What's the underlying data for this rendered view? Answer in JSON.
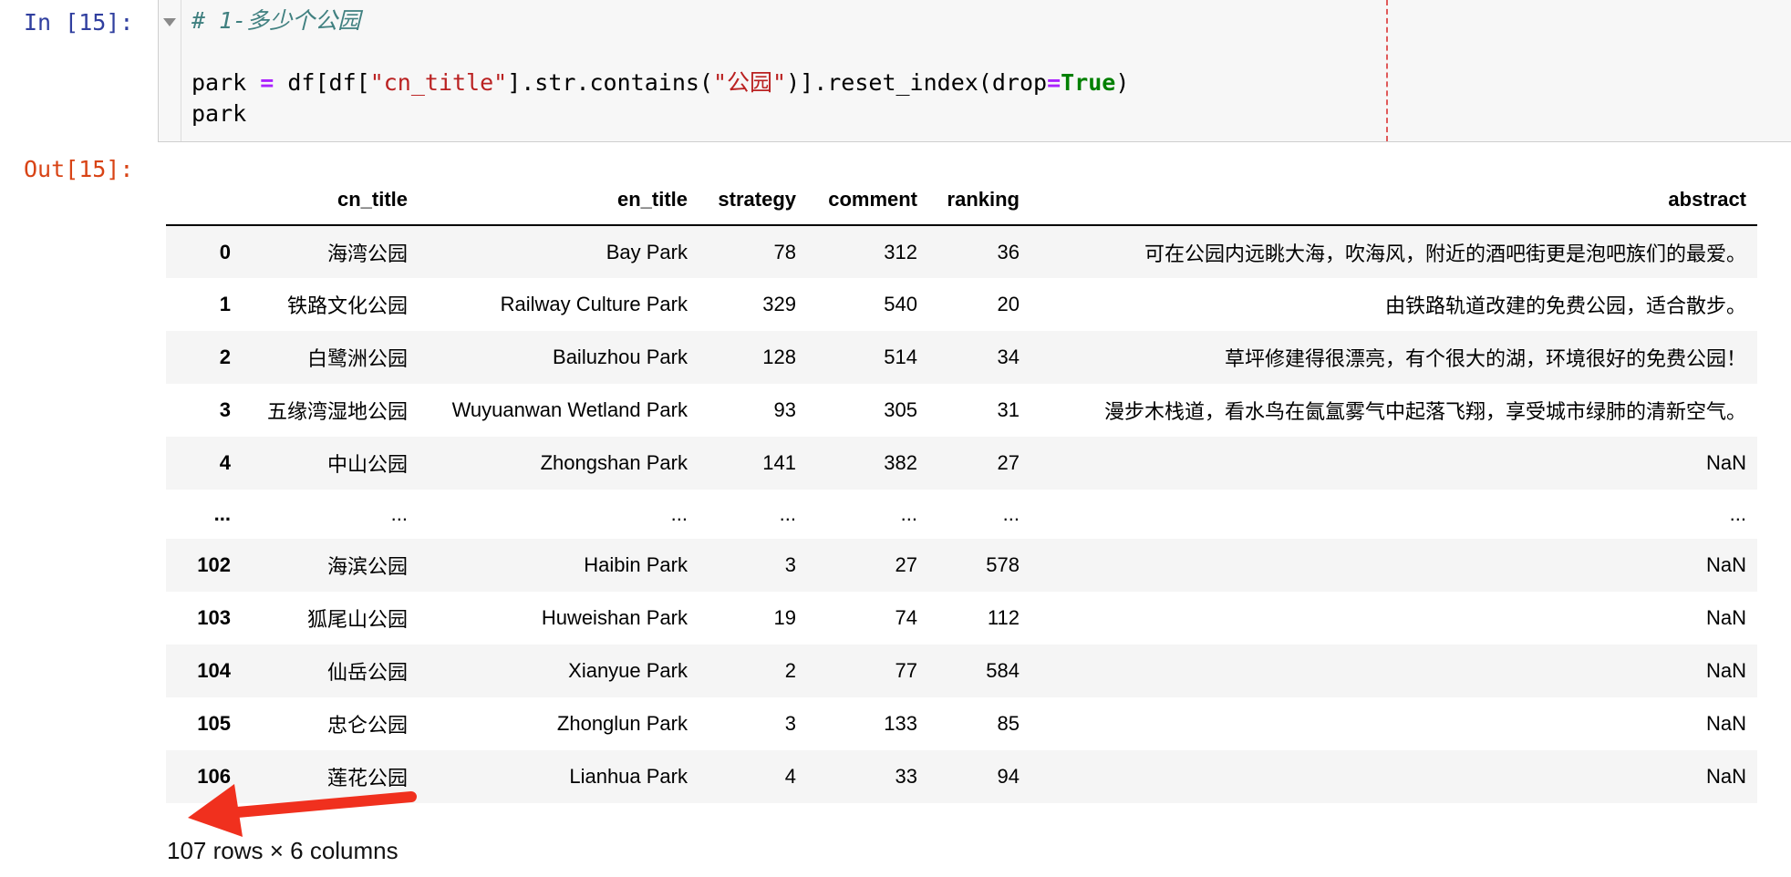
{
  "cell": {
    "in_prompt": "In [15]:",
    "out_prompt": "Out[15]:",
    "code": {
      "comment": "# 1-多少个公园",
      "line2_a": "park ",
      "line2_eq": "=",
      "line2_b": " df[df[",
      "line2_s1": "\"cn_title\"",
      "line2_c": "].str.contains(",
      "line2_s2": "\"公园\"",
      "line2_d": ")].reset_index(drop",
      "line2_eq2": "=",
      "line2_kw": "True",
      "line2_e": ")",
      "line3": "park"
    }
  },
  "table": {
    "columns": [
      "cn_title",
      "en_title",
      "strategy",
      "comment",
      "ranking",
      "abstract"
    ],
    "rows": [
      [
        "0",
        "海湾公园",
        "Bay Park",
        "78",
        "312",
        "36",
        "可在公园内远眺大海，吹海风，附近的酒吧街更是泡吧族们的最爱。"
      ],
      [
        "1",
        "铁路文化公园",
        "Railway Culture Park",
        "329",
        "540",
        "20",
        "由铁路轨道改建的免费公园，适合散步。"
      ],
      [
        "2",
        "白鹭洲公园",
        "Bailuzhou Park",
        "128",
        "514",
        "34",
        "草坪修建得很漂亮，有个很大的湖，环境很好的免费公园！"
      ],
      [
        "3",
        "五缘湾湿地公园",
        "Wuyuanwan Wetland Park",
        "93",
        "305",
        "31",
        "漫步木栈道，看水鸟在氤氲雾气中起落飞翔，享受城市绿肺的清新空气。"
      ],
      [
        "4",
        "中山公园",
        "Zhongshan Park",
        "141",
        "382",
        "27",
        "NaN"
      ],
      [
        "...",
        "...",
        "...",
        "...",
        "...",
        "...",
        "..."
      ],
      [
        "102",
        "海滨公园",
        "Haibin Park",
        "3",
        "27",
        "578",
        "NaN"
      ],
      [
        "103",
        "狐尾山公园",
        "Huweishan Park",
        "19",
        "74",
        "112",
        "NaN"
      ],
      [
        "104",
        "仙岳公园",
        "Xianyue Park",
        "2",
        "77",
        "584",
        "NaN"
      ],
      [
        "105",
        "忠仑公园",
        "Zhonglun Park",
        "3",
        "133",
        "85",
        "NaN"
      ],
      [
        "106",
        "莲花公园",
        "Lianhua Park",
        "4",
        "33",
        "94",
        "NaN"
      ]
    ],
    "shape": "107 rows × 6 columns"
  },
  "annotation": {
    "arrow_color": "#f0301e"
  },
  "colors": {
    "in_prompt": "#303f9f",
    "out_prompt": "#d84315",
    "cell_bg": "#f7f7f7"
  }
}
